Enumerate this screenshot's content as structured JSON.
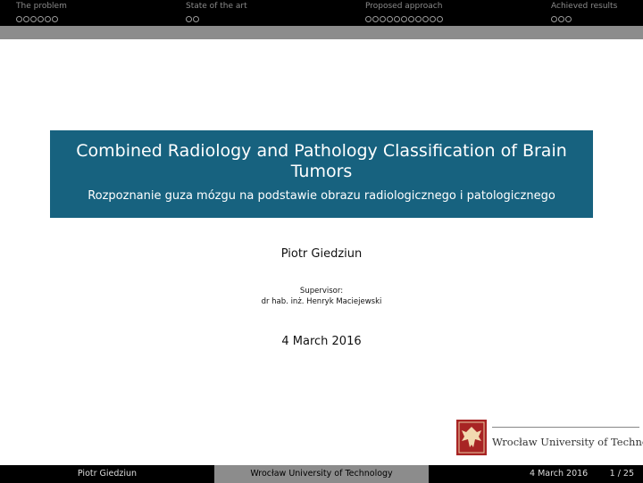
{
  "nav": {
    "sections": [
      {
        "title": "The problem",
        "dots": 6
      },
      {
        "title": "State of the art",
        "dots": 2
      },
      {
        "title": "Proposed approach",
        "dots": 11
      },
      {
        "title": "Achieved results",
        "dots": 3
      }
    ]
  },
  "slide": {
    "title": "Combined Radiology and Pathology Classification of Brain Tumors",
    "subtitle": "Rozpoznanie guza mózgu na podstawie obrazu radiologicznego i patologicznego",
    "author": "Piotr Giedziun",
    "supervisor_label": "Supervisor:",
    "supervisor_name": "dr hab. inż. Henryk Maciejewski",
    "date": "4 March 2016"
  },
  "logo": {
    "text": "Wrocław University of Technology"
  },
  "footer": {
    "author": "Piotr Giedziun",
    "institution": "Wrocław University of Technology",
    "date": "4 March 2016",
    "page": "1 / 25"
  },
  "colors": {
    "title_box": "#17627f",
    "bar_dark": "#000000",
    "bar_gray": "#8c8c8c",
    "logo_red": "#a82424"
  }
}
